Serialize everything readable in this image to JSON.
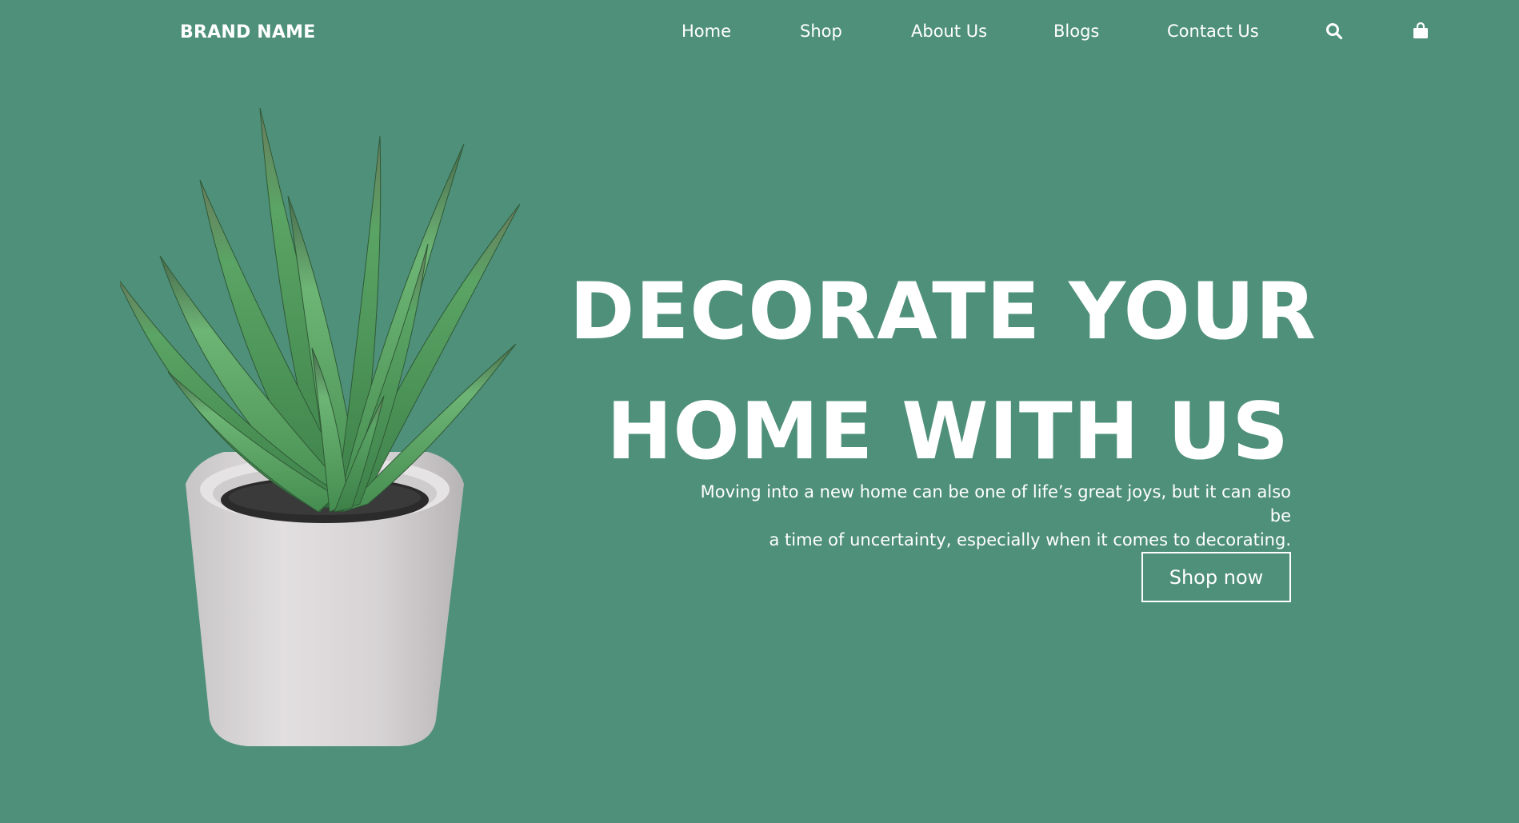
{
  "nav": {
    "brand": "BRAND NAME",
    "links": [
      "Home",
      "Shop",
      "About Us",
      "Blogs",
      "Contact Us"
    ],
    "icons": [
      "search-icon",
      "shopping-bag-icon"
    ]
  },
  "hero": {
    "title_line1": "DECORATE YOUR",
    "title_line2": "HOME WITH US",
    "text_line1": "Moving into a new home can be one of life’s great joys, but it can also be",
    "text_line2": "a time of uncertainty, especially when it comes to decorating.",
    "cta_label": "Shop now",
    "image": "potted-plant-image"
  },
  "colors": {
    "background": "#4f907b",
    "text": "#ffffff",
    "pot": "#d8d5d5",
    "soil": "#2b2b2b",
    "leaf": "#4e9a57"
  }
}
